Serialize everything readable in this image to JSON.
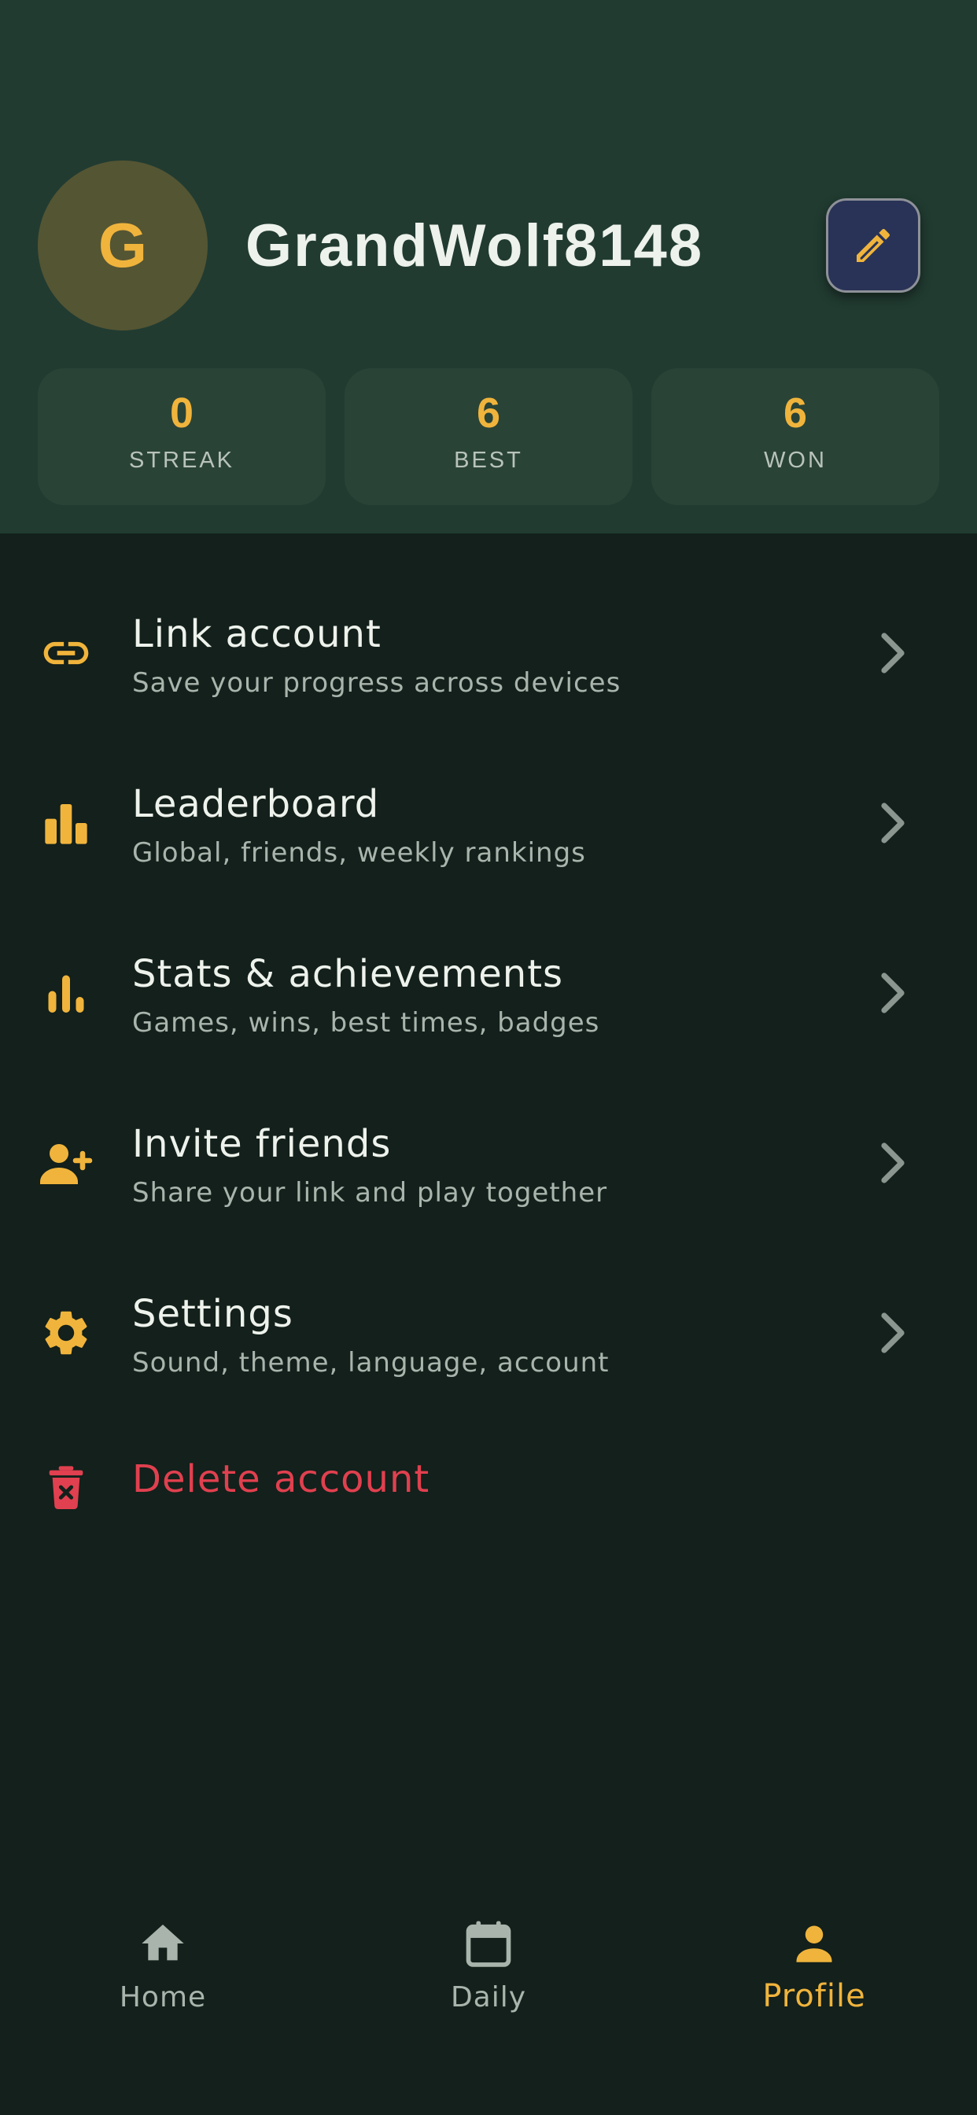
{
  "profile": {
    "avatar_initial": "G",
    "username": "GrandWolf8148"
  },
  "stats": [
    {
      "value": "0",
      "label": "STREAK"
    },
    {
      "value": "6",
      "label": "BEST"
    },
    {
      "value": "6",
      "label": "WON"
    }
  ],
  "menu": {
    "items": [
      {
        "title": "Link account",
        "subtitle": "Save your progress across devices",
        "icon": "link-icon"
      },
      {
        "title": "Leaderboard",
        "subtitle": "Global, friends, weekly rankings",
        "icon": "leaderboard-icon"
      },
      {
        "title": "Stats & achievements",
        "subtitle": "Games, wins, best times, badges",
        "icon": "bar-chart-icon"
      },
      {
        "title": "Invite friends",
        "subtitle": "Share your link and play together",
        "icon": "person-add-icon"
      },
      {
        "title": "Settings",
        "subtitle": "Sound, theme, language, account",
        "icon": "gear-icon"
      }
    ],
    "delete_label": "Delete account"
  },
  "nav": {
    "items": [
      {
        "label": "Home",
        "icon": "home-icon"
      },
      {
        "label": "Daily",
        "icon": "calendar-icon"
      },
      {
        "label": "Profile",
        "icon": "person-icon"
      }
    ],
    "active": "Profile"
  },
  "colors": {
    "accent": "#f0b43c",
    "header_bg": "#213b31",
    "page_bg": "#13201b",
    "danger": "#e0404f",
    "edit_button_bg": "#293357"
  }
}
